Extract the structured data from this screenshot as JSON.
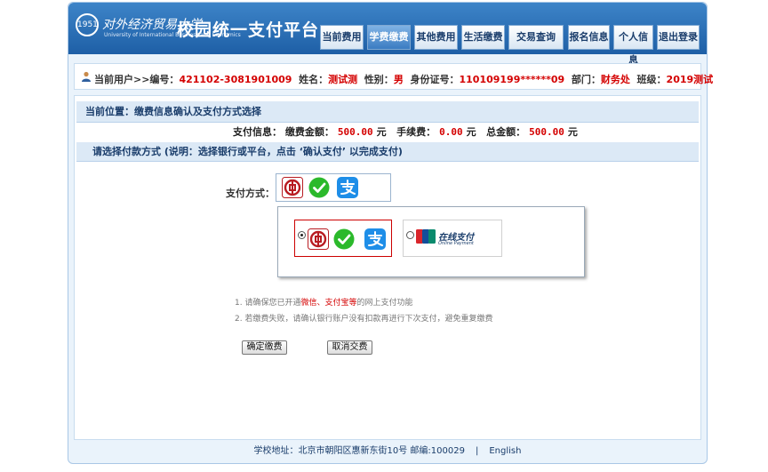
{
  "header": {
    "school_name": "对外经济贸易大学",
    "school_name_en": "University of International Business and Economics",
    "logo_text": "1951",
    "platform_title": "校园统一支付平台",
    "nav": [
      {
        "label": "当前费用"
      },
      {
        "label": "学费缴费"
      },
      {
        "label": "其他费用"
      },
      {
        "label": "生活缴费"
      },
      {
        "label": "交易查询"
      },
      {
        "label": "报名信息"
      },
      {
        "label": "个人信息"
      },
      {
        "label": "退出登录"
      }
    ]
  },
  "userbar": {
    "prefix": "当前用户>>编号：",
    "id": "421102-3081901009",
    "name_label": "姓名：",
    "name": "测试测",
    "gender_label": "性别：",
    "gender": "男",
    "idcard_label": "身份证号：",
    "idcard": "110109199******09",
    "dept_label": "部门：",
    "dept": "财务处",
    "class_label": "班级：",
    "class": "2019测试"
  },
  "main": {
    "breadcrumb": "当前位置：缴费信息确认及支付方式选择",
    "pay_info_label": "支付信息：",
    "fee_label": "缴费金额：",
    "fee_amount": "500.00",
    "handling_label": "手续费：",
    "handling_amount": "0.00",
    "total_label": "总金额：",
    "total_amount": "500.00",
    "unit": "元",
    "hint": "请选择付款方式 (说明：选择银行或平台，点击 ‘确认支付’ 以完成支付)",
    "method_label": "支付方式：",
    "online_pay_text": "在线支付",
    "online_pay_en": "Online Payment",
    "unionpay_label": "UnionPay",
    "note1_prefix": "1. 请确保您已开通",
    "note1_highlight": "微信、支付宝等",
    "note1_suffix": "的网上支付功能",
    "note2": "2. 若缴费失败，请确认银行账户没有扣款再进行下次支付，避免重复缴费",
    "confirm_button": "确定缴费",
    "cancel_button": "取消交费"
  },
  "footer": {
    "address": "学校地址：北京市朝阳区惠新东街10号 邮编:100029",
    "separator": "|",
    "english_link": "English"
  },
  "colors": {
    "header_blue": "#1e5fa6",
    "highlight_red": "#d40000",
    "wechat_green": "#2bb92b",
    "alipay_blue": "#1e8ee8",
    "boc_red": "#b81c22"
  },
  "icons": [
    "boc-icon",
    "wechat-pay-icon",
    "alipay-icon",
    "unionpay-icon",
    "user-icon"
  ]
}
